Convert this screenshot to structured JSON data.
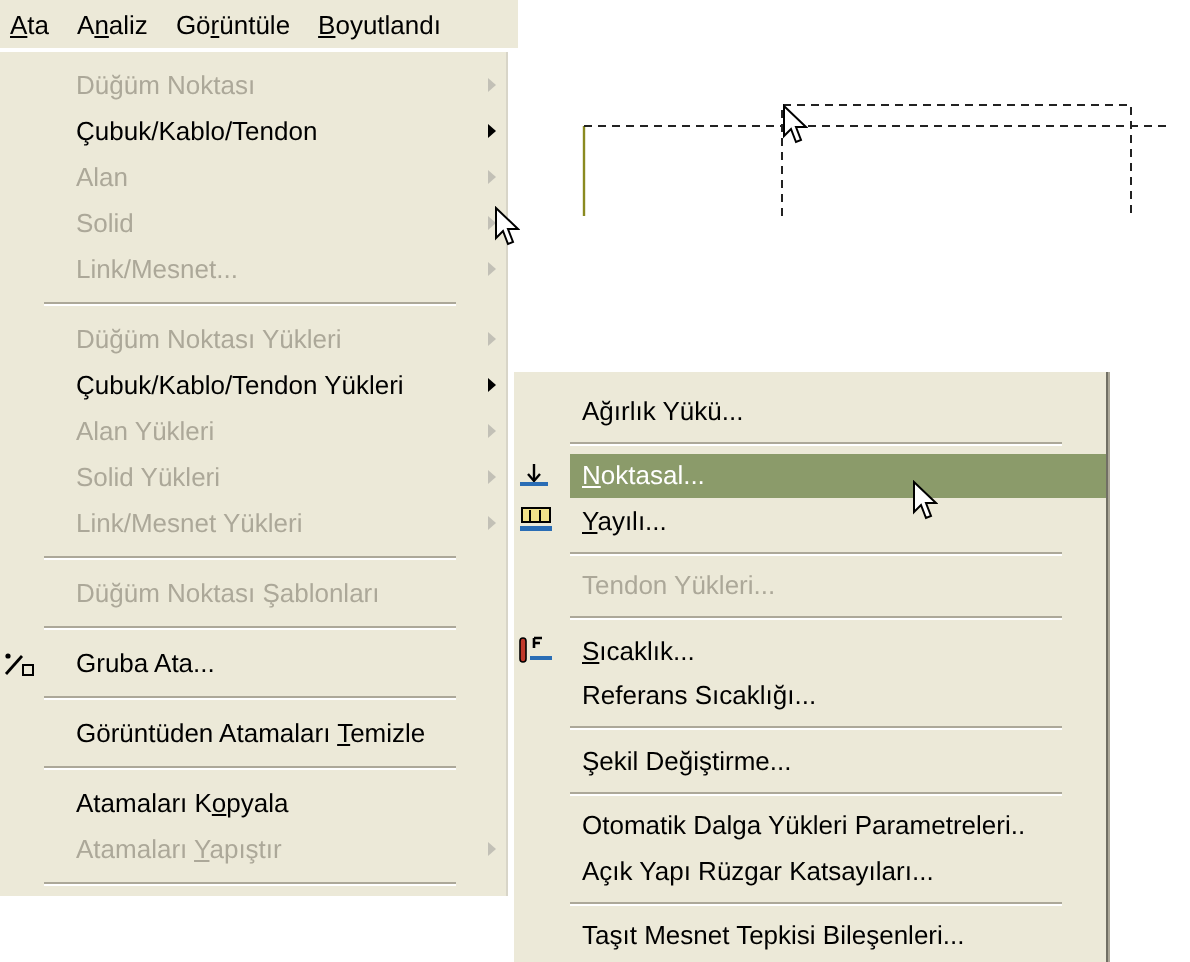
{
  "menu_bar": [
    {
      "key": "A",
      "post": "ta"
    },
    {
      "pre": "A",
      "key": "n",
      "post": "aliz"
    },
    {
      "pre": "Gö",
      "key": "r",
      "post": "üntüle"
    },
    {
      "key": "B",
      "post": "oyutlandı"
    }
  ],
  "menu": [
    {
      "kind": "item",
      "label": "Düğüm Noktası",
      "disabled": true,
      "submenu": true,
      "selected": false
    },
    {
      "kind": "item",
      "label": "Çubuk/Kablo/Tendon",
      "disabled": false,
      "submenu": true,
      "selected": false
    },
    {
      "kind": "item",
      "label": "Alan",
      "disabled": true,
      "submenu": true,
      "selected": false
    },
    {
      "kind": "item",
      "label": "Solid",
      "disabled": true,
      "submenu": true,
      "selected": false
    },
    {
      "kind": "item",
      "label": "Link/Mesnet...",
      "disabled": true,
      "submenu": true,
      "selected": false
    },
    {
      "kind": "separator"
    },
    {
      "kind": "item",
      "label": "Düğüm Noktası Yükleri",
      "disabled": true,
      "submenu": true,
      "selected": false
    },
    {
      "kind": "item",
      "label": "Çubuk/Kablo/Tendon Yükleri",
      "disabled": false,
      "submenu": true,
      "selected": false
    },
    {
      "kind": "item",
      "label": "Alan Yükleri",
      "disabled": true,
      "submenu": true,
      "selected": false
    },
    {
      "kind": "item",
      "label": "Solid Yükleri",
      "disabled": true,
      "submenu": true,
      "selected": false
    },
    {
      "kind": "item",
      "label": "Link/Mesnet Yükleri",
      "disabled": true,
      "submenu": true,
      "selected": false
    },
    {
      "kind": "separator"
    },
    {
      "kind": "item",
      "label": "Düğüm Noktası Şablonları",
      "disabled": true,
      "submenu": false,
      "selected": false
    },
    {
      "kind": "separator"
    },
    {
      "kind": "group-item",
      "label": "Gruba Ata...",
      "disabled": false,
      "submenu": false,
      "selected": false
    },
    {
      "kind": "separator"
    },
    {
      "kind": "item",
      "pre": "Görüntüden Atamaları ",
      "key": "T",
      "post": "emizle",
      "disabled": false,
      "submenu": false,
      "selected": false
    },
    {
      "kind": "separator"
    },
    {
      "kind": "item",
      "pre": "Atamaları K",
      "key": "o",
      "post": "pyala",
      "disabled": false,
      "submenu": false,
      "selected": false
    },
    {
      "kind": "item",
      "pre": "Atamaları ",
      "key": "Y",
      "post": "apıştır",
      "disabled": true,
      "submenu": true,
      "selected": false
    },
    {
      "kind": "separator"
    }
  ],
  "submenu": [
    {
      "kind": "item",
      "label": "Ağırlık Yükü...",
      "disabled": false,
      "selected": false
    },
    {
      "kind": "separator"
    },
    {
      "kind": "point-load-item",
      "key": "N",
      "post": "oktasal...",
      "disabled": false,
      "selected": true
    },
    {
      "kind": "distributed-load-item",
      "key": "Y",
      "post": "ayılı...",
      "disabled": false,
      "selected": false
    },
    {
      "kind": "separator"
    },
    {
      "kind": "item",
      "label": "Tendon Yükleri...",
      "disabled": true,
      "selected": false
    },
    {
      "kind": "separator"
    },
    {
      "kind": "temperature-item",
      "key": "S",
      "post": "ıcaklık...",
      "disabled": false,
      "selected": false
    },
    {
      "kind": "item",
      "label": "Referans Sıcaklığı...",
      "disabled": false,
      "selected": false
    },
    {
      "kind": "separator"
    },
    {
      "kind": "item",
      "label": "Şekil Değiştirme...",
      "disabled": false,
      "selected": false
    },
    {
      "kind": "separator"
    },
    {
      "kind": "item",
      "label": "Otomatik Dalga Yükleri Parametreleri..",
      "disabled": false,
      "selected": false
    },
    {
      "kind": "item",
      "label": "Açık Yapı Rüzgar Katsayıları...",
      "disabled": false,
      "selected": false
    },
    {
      "kind": "separator"
    },
    {
      "kind": "item",
      "label": "Taşıt Mesnet Tepkisi Bileşenleri...",
      "disabled": false,
      "selected": false
    }
  ]
}
